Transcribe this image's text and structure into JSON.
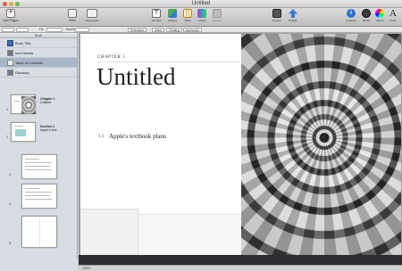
{
  "window": {
    "title": "Untitled"
  },
  "toolbar": {
    "add_pages": "Add Pages",
    "view": "View",
    "orientation": "Orientation",
    "text_box": "Text Box",
    "shapes": "Shapes",
    "table": "Table",
    "charts": "Charts",
    "widgets": "Widgets",
    "preview": "Preview",
    "publish": "Publish",
    "inspector": "Inspector",
    "media": "Media",
    "colors": "Colors",
    "fonts": "Fonts",
    "fonts_glyph": "A",
    "textbox_glyph": "T",
    "inspector_glyph": "i"
  },
  "formatbar": {
    "size": "Fill",
    "style": "Baseline",
    "items": [
      "Prelocked",
      "Inline",
      "Floating",
      "Anchored"
    ]
  },
  "sidebar": {
    "header": "Book",
    "items": [
      {
        "label": "Book Title"
      },
      {
        "label": "Intro Media"
      },
      {
        "label": "Table of Contents",
        "selected": true
      },
      {
        "label": "Glossary"
      }
    ],
    "pages": [
      {
        "num": "1",
        "caption_bold": "Chapter 1",
        "caption": "Untitled"
      },
      {
        "num": "2",
        "caption_bold": "Section 1",
        "caption": "Apple's text"
      },
      {
        "num": "3"
      },
      {
        "num": "4"
      },
      {
        "num": "5"
      }
    ]
  },
  "page": {
    "chapter_label": "CHAPTER 1",
    "chapter_title": "Untitled",
    "section_number": "1.1",
    "section_title": "Apple's textbook plans"
  },
  "statusbar": {
    "zoom": "100%"
  }
}
